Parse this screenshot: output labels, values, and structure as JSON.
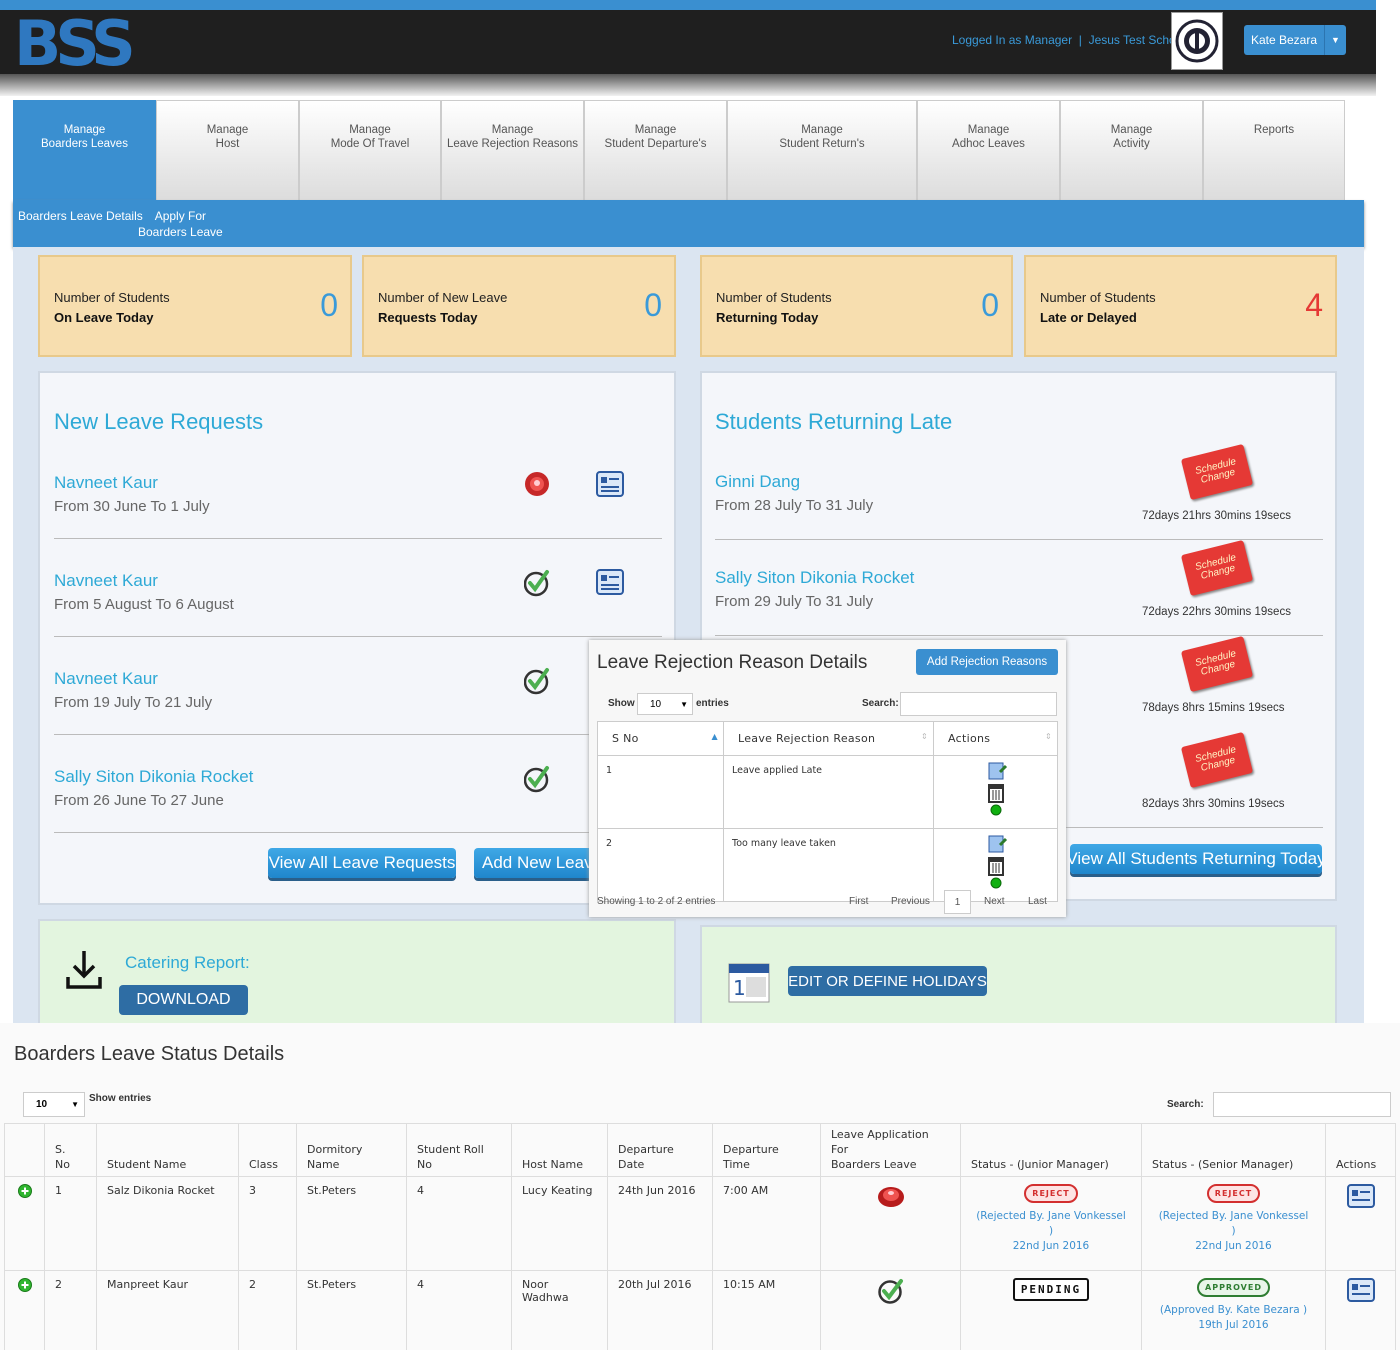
{
  "header": {
    "logo": "BSS",
    "logged_in": "Logged In as Manager",
    "separator": "|",
    "school": "Jesus Test School",
    "user_name": "Kate Bezara"
  },
  "tabs": [
    {
      "label": "Manage\nBoarders Leaves",
      "active": true
    },
    {
      "label": "Manage\nHost"
    },
    {
      "label": "Manage\nMode Of Travel"
    },
    {
      "label": "Manage\nLeave Rejection Reasons"
    },
    {
      "label": "Manage\nStudent Departure's"
    },
    {
      "label": "Manage\nStudent Return's"
    },
    {
      "label": "Manage\nAdhoc Leaves"
    },
    {
      "label": "Manage\nActivity"
    },
    {
      "label": "Reports"
    }
  ],
  "subnav": {
    "item1": "Boarders Leave Details",
    "item2": "Apply For\nBoarders Leave"
  },
  "stats": [
    {
      "line1": "Number of Students",
      "line2": "On Leave Today",
      "value": "0"
    },
    {
      "line1": "Number of New Leave",
      "line2": "Requests Today",
      "value": "0"
    },
    {
      "line1": "Number of Students",
      "line2": "Returning Today",
      "value": "0"
    },
    {
      "line1": "Number of Students",
      "line2": "Late or Delayed",
      "value": "4"
    }
  ],
  "new_requests": {
    "title": "New Leave Requests",
    "items": [
      {
        "name": "Navneet Kaur",
        "dates": "From 30 June To 1 July",
        "status_icon": "red-button-icon"
      },
      {
        "name": "Navneet Kaur",
        "dates": "From 5 August To 6 August",
        "status_icon": "check-icon"
      },
      {
        "name": "Navneet Kaur",
        "dates": "From 19 July To 21 July",
        "status_icon": "check-icon"
      },
      {
        "name": "Sally Siton Dikonia Rocket",
        "dates": "From 26 June To 27 June",
        "status_icon": "check-icon"
      }
    ],
    "view_all": "View All Leave Requests",
    "add_new": "Add New Leave"
  },
  "returning_late": {
    "title": "Students Returning Late",
    "badge": "Schedule\nChange",
    "items": [
      {
        "name": "Ginni Dang",
        "dates": "From 28 July To 31 July",
        "overdue": "72days 21hrs 30mins 19secs"
      },
      {
        "name": "Sally Siton Dikonia Rocket",
        "dates": "From 29 July To 31 July",
        "overdue": "72days 22hrs 30mins 19secs"
      },
      {
        "overdue": "78days 8hrs 15mins 19secs"
      },
      {
        "overdue": "82days 3hrs 30mins 19secs"
      }
    ],
    "view_all": "View All Students Returning Today"
  },
  "catering": {
    "label": "Catering Report:",
    "download": "DOWNLOAD"
  },
  "holidays": {
    "button": "EDIT OR DEFINE HOLIDAYS"
  },
  "modal": {
    "title": "Leave Rejection Reason Details",
    "add_button": "Add Rejection Reasons",
    "show": "Show",
    "entries_value": "10",
    "entries": "entries",
    "search_label": "Search:",
    "columns": [
      "S No",
      "Leave Rejection Reason",
      "Actions"
    ],
    "rows": [
      {
        "sno": "1",
        "reason": "Leave applied Late"
      },
      {
        "sno": "2",
        "reason": "Too many leave taken"
      }
    ],
    "info": "Showing 1 to 2 of 2 entries",
    "pagination": {
      "first": "First",
      "previous": "Previous",
      "page": "1",
      "next": "Next",
      "last": "Last"
    }
  },
  "status_section": {
    "title": "Boarders Leave Status Details",
    "entries_value": "10",
    "show_entries": "Show entries",
    "search_label": "Search:",
    "columns": [
      "",
      "S.\nNo",
      "Student Name",
      "Class",
      "Dormitory\nName",
      "Student Roll\nNo",
      "Host Name",
      "Departure\nDate",
      "Departure\nTime",
      "Leave Application\nFor\nBoarders Leave",
      "Status - (Junior Manager)",
      "Status - (Senior Manager)",
      "Actions"
    ],
    "rows": [
      {
        "sno": "1",
        "student": "Salz Dikonia Rocket",
        "class": "3",
        "dorm": "St.Peters",
        "roll": "4",
        "host": "Lucy Keating",
        "date": "24th Jun 2016",
        "time": "7:00 AM",
        "junior_stamp": "REJECT",
        "junior_note": "(Rejected By. Jane Vonkessel\n)",
        "junior_date": "22nd Jun 2016",
        "senior_stamp": "REJECT",
        "senior_note": "(Rejected By. Jane Vonkessel\n)",
        "senior_date": "22nd Jun 2016"
      },
      {
        "sno": "2",
        "student": "Manpreet Kaur",
        "class": "2",
        "dorm": "St.Peters",
        "roll": "4",
        "host": "Noor Wadhwa",
        "date": "20th Jul 2016",
        "time": "10:15 AM",
        "junior_stamp": "PENDING",
        "senior_stamp": "APPROVED",
        "senior_note": "(Approved By. Kate Bezara )",
        "senior_date": "19th Jul 2016"
      }
    ]
  },
  "colors": {
    "accent": "#3a8fd0",
    "stat_bg": "#f7deaf",
    "link": "#2ea9d6",
    "late": "#e53935"
  }
}
